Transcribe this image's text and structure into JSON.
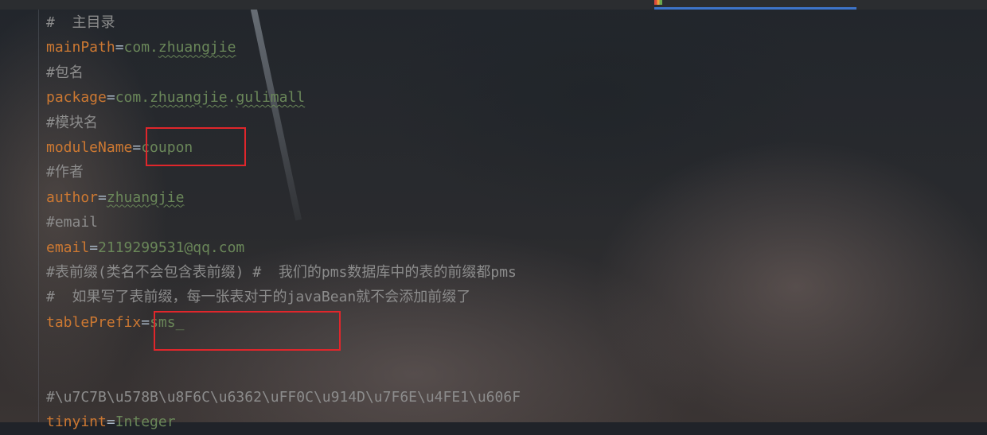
{
  "editor": {
    "lines": [
      {
        "type": "comment",
        "text": "#  主目录"
      },
      {
        "type": "kv",
        "key": "mainPath",
        "eq": "=",
        "parts": [
          {
            "t": "com.",
            "s": false
          },
          {
            "t": "zhuangjie",
            "s": true
          }
        ]
      },
      {
        "type": "comment",
        "text": "#包名"
      },
      {
        "type": "kv",
        "key": "package",
        "eq": "=",
        "parts": [
          {
            "t": "com.",
            "s": false
          },
          {
            "t": "zhuangjie",
            "s": true
          },
          {
            "t": ".",
            "s": false
          },
          {
            "t": "gulimall",
            "s": true
          }
        ]
      },
      {
        "type": "comment",
        "text": "#模块名"
      },
      {
        "type": "kv",
        "key": "moduleName",
        "eq": "=",
        "parts": [
          {
            "t": "coupon",
            "s": false
          }
        ]
      },
      {
        "type": "comment",
        "text": "#作者"
      },
      {
        "type": "kv",
        "key": "author",
        "eq": "=",
        "parts": [
          {
            "t": "zhuangjie",
            "s": true
          }
        ]
      },
      {
        "type": "comment",
        "text": "#email"
      },
      {
        "type": "kv",
        "key": "email",
        "eq": "=",
        "parts": [
          {
            "t": "2119299531@qq.com",
            "s": false
          }
        ]
      },
      {
        "type": "comment",
        "text": "#表前缀(类名不会包含表前缀) #  我们的pms数据库中的表的前缀都pms"
      },
      {
        "type": "comment",
        "text": "#  如果写了表前缀，每一张表对于的javaBean就不会添加前缀了"
      },
      {
        "type": "kv",
        "key": "tablePrefix",
        "eq": "=",
        "parts": [
          {
            "t": "sms_",
            "s": false
          }
        ]
      },
      {
        "type": "blank",
        "text": ""
      },
      {
        "type": "blank",
        "text": ""
      },
      {
        "type": "comment",
        "text": "#\\u7C7B\\u578B\\u8F6C\\u6362\\uFF0C\\u914D\\u7F6E\\u4FE1\\u606F"
      },
      {
        "type": "kv",
        "key": "tinyint",
        "eq": "=",
        "parts": [
          {
            "t": "Integer",
            "s": false
          }
        ]
      }
    ]
  },
  "colors": {
    "comment": "#8c8c8c",
    "key": "#cc7832",
    "value": "#6a8759",
    "highlight_box": "#e0262b",
    "active_tab": "#3d74c9"
  }
}
